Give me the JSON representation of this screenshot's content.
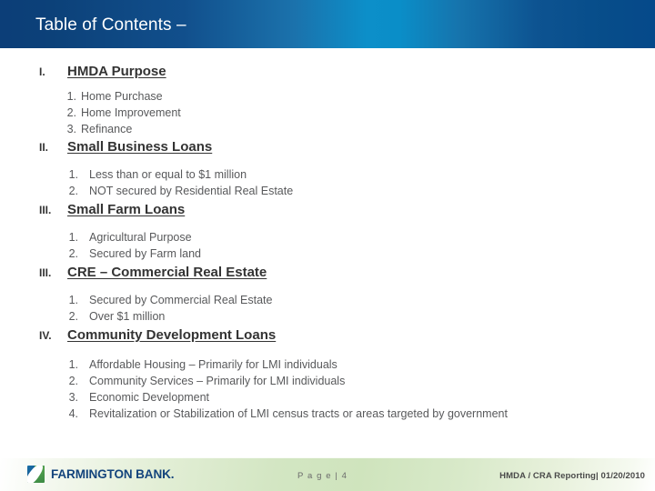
{
  "slide": {
    "title": "Table of Contents –",
    "header_gradient_start": "#0c3e78",
    "header_gradient_mid": "#0a8fc9",
    "header_gradient_end": "#05498a",
    "text_color": "#58595b",
    "heading_color": "#333333"
  },
  "sections": [
    {
      "numeral": "I.",
      "title": "HMDA Purpose",
      "items": [
        {
          "num": "1.",
          "text": "Home Purchase"
        },
        {
          "num": "2.",
          "text": "Home Improvement"
        },
        {
          "num": "3.",
          "text": "Refinance"
        }
      ]
    },
    {
      "numeral": "II.",
      "title": "Small Business Loans",
      "items": [
        {
          "num": "1.",
          "text": "Less than or equal to $1 million"
        },
        {
          "num": "2.",
          "text": "NOT secured by Residential Real Estate"
        }
      ]
    },
    {
      "numeral": "III.",
      "title": "Small Farm Loans",
      "items": [
        {
          "num": "1.",
          "text": "Agricultural Purpose"
        },
        {
          "num": "2.",
          "text": "Secured by Farm land"
        }
      ]
    },
    {
      "numeral": "III.",
      "title": "CRE – Commercial Real Estate",
      "items": [
        {
          "num": "1.",
          "text": "Secured by Commercial Real Estate"
        },
        {
          "num": "2.",
          "text": "Over $1 million"
        }
      ]
    },
    {
      "numeral": "IV.",
      "title": "Community Development Loans",
      "items": [
        {
          "num": "1.",
          "text": "Affordable Housing – Primarily for LMI individuals"
        },
        {
          "num": "2.",
          "text": "Community Services – Primarily for LMI individuals"
        },
        {
          "num": "3.",
          "text": "Economic Development"
        },
        {
          "num": "4.",
          "text": "Revitalization or Stabilization of LMI census tracts or areas targeted by government"
        }
      ]
    }
  ],
  "footer": {
    "logo_name": "FARMINGTON BANK.",
    "logo_icon": "leaf-mark-icon",
    "page_label": "P a g e | 4",
    "right_text": "HMDA / CRA Reporting| 01/20/2010",
    "band_color": "#cfe4bd"
  }
}
